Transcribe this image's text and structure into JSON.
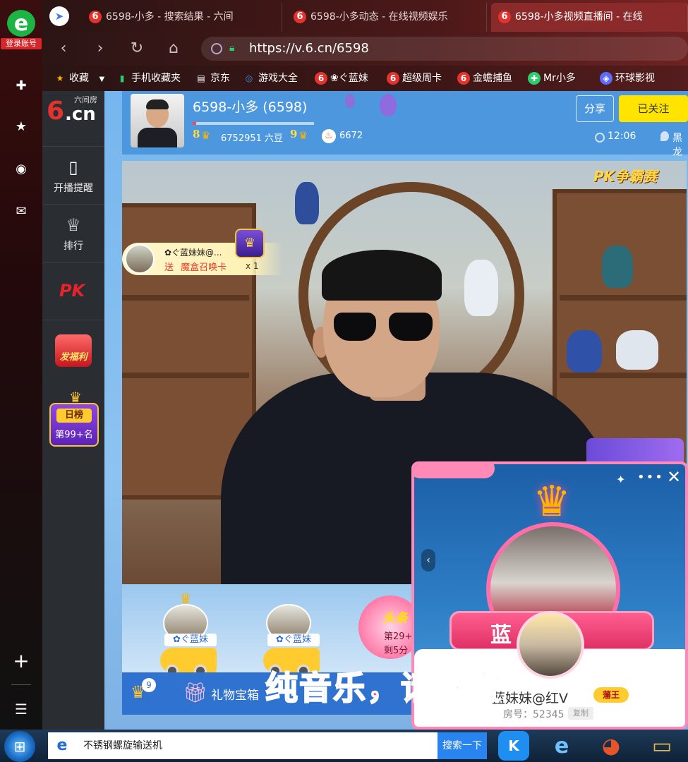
{
  "browser": {
    "sidebar": {
      "login_label": "登录账号",
      "logo_glyph": "e",
      "apps": [
        {
          "name": "plus-cross-app",
          "glyph": "✚",
          "color": "#1ec7c2"
        },
        {
          "name": "star-app",
          "glyph": "★",
          "color": "#f4a51a"
        },
        {
          "name": "weibo-app",
          "glyph": "◉",
          "color": "#e8542a"
        },
        {
          "name": "mail-app",
          "glyph": "✉",
          "color": "#27b45a"
        }
      ],
      "add_glyph": "+",
      "list_glyph": "☰"
    },
    "tabs": [
      {
        "label": "6598-小多 - 搜索结果 - 六间",
        "active": false
      },
      {
        "label": "6598-小多动态 - 在线视频娱乐",
        "active": false
      },
      {
        "label": "6598-小多视频直播间 - 在线",
        "active": true
      }
    ],
    "tab_icon_glyph": "6",
    "url": "https://v.6.cn/6598",
    "bookmarks": [
      {
        "label": "收藏",
        "glyph": "★",
        "color": "#ffb400"
      },
      {
        "label": "手机收藏夹",
        "glyph": "▮",
        "color": "#2ecc71"
      },
      {
        "label": "京东",
        "glyph": "▤",
        "color": "#ffffff"
      },
      {
        "label": "游戏大全",
        "glyph": "◎",
        "color": "#3a8fe8"
      },
      {
        "label": "❀ぐ蓝妹",
        "glyph": "6",
        "color": "#e5322d"
      },
      {
        "label": "超级周卡",
        "glyph": "6",
        "color": "#e5322d"
      },
      {
        "label": "金蟾捕鱼",
        "glyph": "6",
        "color": "#e5322d"
      },
      {
        "label": "Mr小多",
        "glyph": "✚",
        "color": "#2ecc71"
      },
      {
        "label": "环球影视",
        "glyph": "◈",
        "color": "#5b6bff"
      }
    ]
  },
  "site": {
    "logo_six": "6",
    "logo_cn": ".cn",
    "logo_sub": "六间房",
    "nav": [
      {
        "label": "开播提醒",
        "glyph": "▯"
      },
      {
        "label": "排行",
        "glyph": "♕"
      }
    ],
    "pk_label": "PK",
    "fuli_label": "发福利",
    "rank": {
      "title": "日榜",
      "sub": "第99+名"
    }
  },
  "anchor": {
    "name": "6598-小多 (6598)",
    "progress": 0.03,
    "level_left": "8",
    "beans": "6752951 六豆",
    "level_right": "9",
    "popularity": "6672",
    "share_label": "分享",
    "follow_label": "已关注",
    "time": "12:06",
    "location": "黑龙江"
  },
  "video": {
    "pk_badge": "PK争霸赛"
  },
  "gift_notice": {
    "name": "✿ぐ蓝妹妹@...",
    "send_prefix": "送",
    "gift": "魔盒召唤卡",
    "count": "x 1"
  },
  "seats": [
    {
      "name": "✿ぐ蓝妹"
    },
    {
      "name": "✿ぐ蓝妹"
    }
  ],
  "headline": {
    "title": "头条",
    "rank": "第29+",
    "remain": "剩5分"
  },
  "gift_bar": {
    "badge_count": "9",
    "box_label": "礼物宝箱"
  },
  "caption": "纯音乐，请欣赏",
  "popup": {
    "nameplate": "蓝妹",
    "card_name": "蓝妹妹@红V",
    "card_tag": "藩王",
    "room": "房号：52345",
    "room_tag": "复制"
  },
  "taskbar": {
    "search_text": "不锈钢螺旋输送机",
    "search_button": "搜索一下",
    "apps": [
      {
        "name": "kugou-app",
        "glyph": "K",
        "color": "#1e8ff0"
      },
      {
        "name": "ie-app",
        "glyph": "e",
        "color": "#2d6bd3"
      },
      {
        "name": "chrome-like-app",
        "glyph": "◕",
        "color": "#e8542a"
      },
      {
        "name": "explorer-app",
        "glyph": "▭",
        "color": "#e2b64a"
      }
    ]
  }
}
